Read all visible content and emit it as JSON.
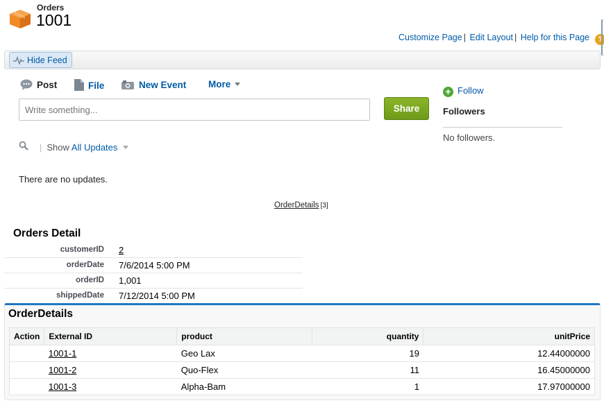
{
  "header": {
    "object_type": "Orders",
    "record_name": "1001",
    "icon": "orders-box-icon",
    "links": [
      "Customize Page",
      "Edit Layout",
      "Help for this Page"
    ]
  },
  "feed": {
    "hide_feed_label": "Hide Feed",
    "tabs": [
      {
        "label": "Post",
        "icon": "post-bubble-icon"
      },
      {
        "label": "File",
        "icon": "file-icon"
      },
      {
        "label": "New Event",
        "icon": "event-icon"
      },
      {
        "label": "More",
        "icon": "chevron-down-icon"
      }
    ],
    "placeholder": "Write something...",
    "share_label": "Share",
    "show_label": "Show",
    "filter_value": "All Updates",
    "empty_message": "There are no updates."
  },
  "followers": {
    "follow_label": "Follow",
    "title": "Followers",
    "empty": "No followers."
  },
  "related_link": {
    "label": "OrderDetails",
    "count": "[3]"
  },
  "detail": {
    "title": "Orders Detail",
    "fields": [
      {
        "label": "customerID",
        "value": "2"
      },
      {
        "label": "orderDate",
        "value": "7/6/2014 5:00 PM"
      },
      {
        "label": "orderID",
        "value": "1,001"
      },
      {
        "label": "shippedDate",
        "value": "7/12/2014 5:00 PM"
      }
    ]
  },
  "order_details": {
    "title": "OrderDetails",
    "columns": [
      "Action",
      "External ID",
      "product",
      "quantity",
      "unitPrice"
    ],
    "rows": [
      {
        "external_id": "1001-1",
        "product": "Geo Lax",
        "quantity": "19",
        "unit_price": "12.44000000"
      },
      {
        "external_id": "1001-2",
        "product": "Quo-Flex",
        "quantity": "11",
        "unit_price": "16.45000000"
      },
      {
        "external_id": "1001-3",
        "product": "Alpha-Bam",
        "quantity": "1",
        "unit_price": "17.97000000"
      }
    ]
  },
  "colors": {
    "link": "#015ba7",
    "share_button": "#7aa822",
    "related_list_accent": "#1f77c2",
    "help_icon": "#e8a317",
    "follow_icon": "#4ea837"
  }
}
